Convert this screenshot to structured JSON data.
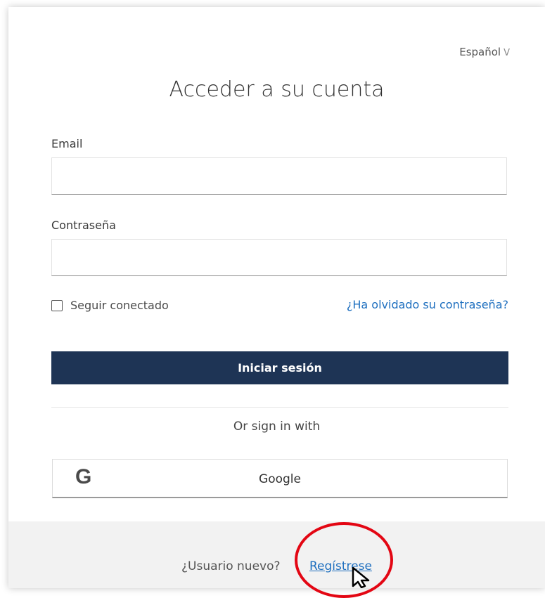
{
  "language": {
    "label": "Español",
    "chevron": "V"
  },
  "title": "Acceder a su cuenta",
  "email": {
    "label": "Email",
    "value": "",
    "placeholder": ""
  },
  "password": {
    "label": "Contraseña",
    "value": "",
    "placeholder": ""
  },
  "remember": {
    "label": "Seguir conectado",
    "checked": false
  },
  "forgot_link": "¿Ha olvidado su contraseña?",
  "signin_button": "Iniciar sesión",
  "social": {
    "heading": "Or sign in with",
    "google_icon": "G",
    "google_label": "Google"
  },
  "footer": {
    "new_user": "¿Usuario nuevo?",
    "register_link": "Regístrese"
  },
  "colors": {
    "primary_button": "#1e3455",
    "link": "#1e6fbf",
    "annotation": "#e30613",
    "footer_bg": "#f2f2f2"
  },
  "icons": [
    "chevron-down-icon",
    "checkbox-icon",
    "google-icon",
    "mouse-cursor-icon"
  ]
}
